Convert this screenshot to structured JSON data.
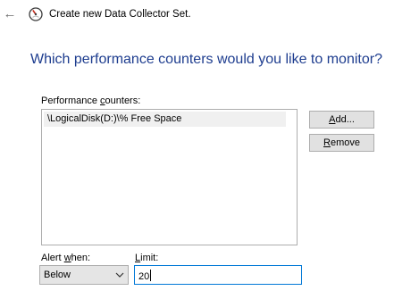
{
  "header": {
    "title": "Create new Data Collector Set.",
    "back_icon": "back-arrow-icon",
    "app_icon": "perfmon-gauge-icon"
  },
  "main": {
    "heading": "Which performance counters would you like to monitor?",
    "counters_label_pre": "Performance ",
    "counters_label_key": "c",
    "counters_label_post": "ounters:",
    "counters": [
      "\\LogicalDisk(D:)\\% Free Space"
    ],
    "add_button": {
      "pre": "",
      "key": "A",
      "post": "dd..."
    },
    "remove_button": {
      "pre": "",
      "key": "R",
      "post": "emove"
    },
    "alert_when": {
      "label_pre": "Alert ",
      "label_key": "w",
      "label_post": "hen:",
      "selected": "Below"
    },
    "limit": {
      "label_pre": "",
      "label_key": "L",
      "label_post": "imit:",
      "value": "20"
    }
  },
  "colors": {
    "heading": "#1e3d8f",
    "focus_border": "#0078d7",
    "button_bg": "#e1e1e1"
  }
}
